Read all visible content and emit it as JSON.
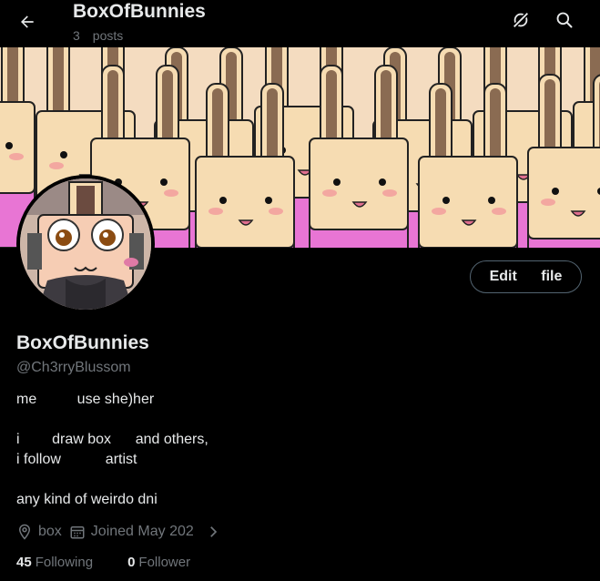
{
  "header": {
    "title": "BoxOfBunnies",
    "post_count": "3",
    "posts_label": "posts",
    "back_icon": "arrow-left-icon",
    "grok_icon": "grok-icon",
    "search_icon": "search-icon"
  },
  "profile": {
    "display_name": "BoxOfBunnies",
    "handle": "@Ch3rryBlussom",
    "edit_button": "Edit file",
    "bio_line1": "me          use she)her",
    "bio_line2": "",
    "bio_line3": "i        draw box      and others,",
    "bio_line4": "i follow           artist",
    "bio_line5": "",
    "bio_line6": "any kind of weirdo dni",
    "location": "box",
    "joined": "Joined May 202",
    "following_count": "45",
    "following_label": "Following",
    "followers_count": "0",
    "followers_label": "Follower"
  },
  "colors": {
    "background": "#000000",
    "text_primary": "#e7e9ea",
    "text_secondary": "#71767b",
    "border": "#536471",
    "banner_pink": "#e875d4",
    "banner_skin": "#f6dcb2",
    "banner_ears": "#8a6b52"
  }
}
